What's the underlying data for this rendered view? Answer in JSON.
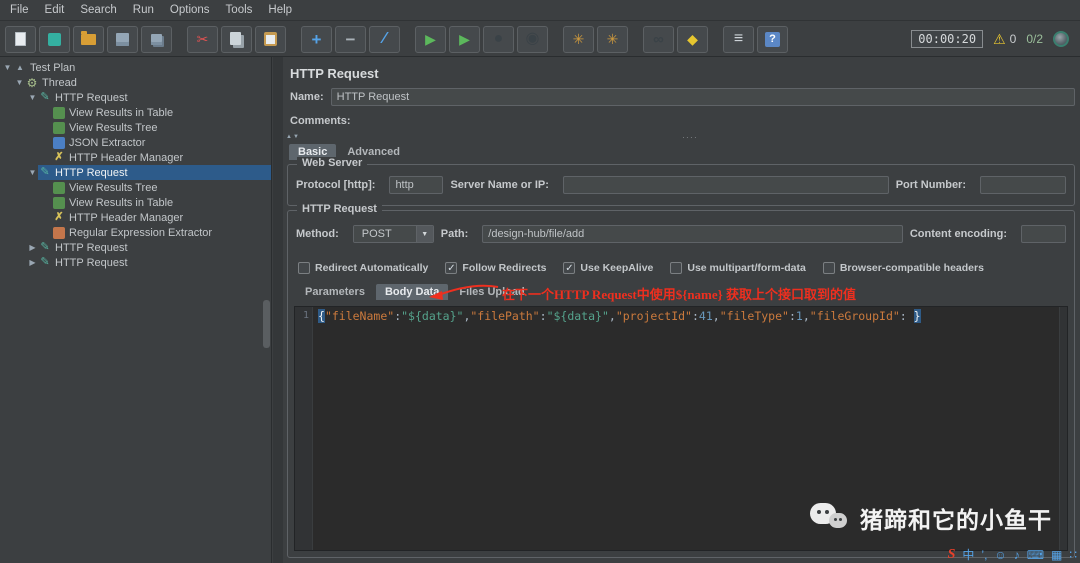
{
  "colors": {
    "selection": "#2d5b8a",
    "annotation_red": "#ee2f1f",
    "accent_blue": "#55a3e8",
    "editor_bg": "#2b2b2b"
  },
  "icons": {
    "dropdown": "▼"
  },
  "menu": {
    "items": [
      "File",
      "Edit",
      "Search",
      "Run",
      "Options",
      "Tools",
      "Help"
    ]
  },
  "toolbar": {
    "buttons": [
      {
        "name": "new-file",
        "glyph": ""
      },
      {
        "name": "open-templates",
        "glyph": ""
      },
      {
        "name": "open-file",
        "glyph": ""
      },
      {
        "name": "save",
        "glyph": ""
      },
      {
        "name": "save-as",
        "glyph": ""
      },
      {
        "name": "cut",
        "glyph": "✂"
      },
      {
        "name": "copy",
        "glyph": ""
      },
      {
        "name": "paste",
        "glyph": ""
      },
      {
        "name": "expand-all",
        "glyph": "+"
      },
      {
        "name": "collapse-all",
        "glyph": "−"
      },
      {
        "name": "toggle",
        "glyph": "∕"
      },
      {
        "name": "start",
        "glyph": "▶"
      },
      {
        "name": "start-no-timers",
        "glyph": "▶"
      },
      {
        "name": "stop",
        "glyph": "●"
      },
      {
        "name": "shutdown",
        "glyph": "◉"
      },
      {
        "name": "clear",
        "glyph": "✳"
      },
      {
        "name": "clear-all",
        "glyph": "✳"
      },
      {
        "name": "search",
        "glyph": "∞"
      },
      {
        "name": "function-helper",
        "glyph": "◆"
      },
      {
        "name": "toggle-view",
        "glyph": "≡"
      },
      {
        "name": "help",
        "glyph": "?"
      }
    ],
    "timer": "00:00:20",
    "warning_icon": "⚠",
    "warning_count": "0",
    "thread_ratio": "0/2"
  },
  "tree": {
    "items": [
      {
        "label": "Test Plan",
        "icon": "test-plan-icon",
        "state": "expanded",
        "selected": false
      },
      {
        "label": "Thread",
        "icon": "thread-group-icon",
        "state": "expanded",
        "selected": false
      },
      {
        "label": "HTTP Request",
        "icon": "http-request-icon",
        "state": "expanded",
        "selected": false
      },
      {
        "label": "View Results in Table",
        "icon": "listener-table-icon",
        "state": "leaf",
        "selected": false
      },
      {
        "label": "View Results Tree",
        "icon": "listener-tree-icon",
        "state": "leaf",
        "selected": false
      },
      {
        "label": "JSON Extractor",
        "icon": "json-extractor-icon",
        "state": "leaf",
        "selected": false
      },
      {
        "label": "HTTP Header Manager",
        "icon": "header-manager-icon",
        "state": "leaf",
        "selected": false
      },
      {
        "label": "HTTP Request",
        "icon": "http-request-icon",
        "state": "expanded",
        "selected": true
      },
      {
        "label": "View Results Tree",
        "icon": "listener-tree-icon",
        "state": "leaf",
        "selected": false
      },
      {
        "label": "View Results in Table",
        "icon": "listener-table-icon",
        "state": "leaf",
        "selected": false
      },
      {
        "label": "HTTP Header Manager",
        "icon": "header-manager-icon",
        "state": "leaf",
        "selected": false
      },
      {
        "label": "Regular Expression Extractor",
        "icon": "regex-extractor-icon",
        "state": "leaf",
        "selected": false
      },
      {
        "label": "HTTP Request",
        "icon": "http-request-icon",
        "state": "collapsed",
        "selected": false
      },
      {
        "label": "HTTP Request",
        "icon": "http-request-icon",
        "state": "collapsed",
        "selected": false
      }
    ]
  },
  "panel": {
    "title": "HTTP Request",
    "name": {
      "label": "Name:",
      "value": "HTTP Request"
    },
    "comments": {
      "label": "Comments:",
      "value": ""
    },
    "tabs": [
      {
        "label": "Basic",
        "selected": true
      },
      {
        "label": "Advanced",
        "selected": false
      }
    ],
    "web_server": {
      "title": "Web Server",
      "protocol": {
        "label": "Protocol [http]:",
        "value": "http"
      },
      "server": {
        "label": "Server Name or IP:",
        "value": ""
      },
      "port": {
        "label": "Port Number:",
        "value": ""
      }
    },
    "http_request": {
      "title": "HTTP Request",
      "method": {
        "label": "Method:",
        "value": "POST"
      },
      "path": {
        "label": "Path:",
        "value": "/design-hub/file/add"
      },
      "content_encoding": {
        "label": "Content encoding:",
        "value": ""
      },
      "options": [
        {
          "label": "Redirect Automatically",
          "checked": false
        },
        {
          "label": "Follow Redirects",
          "checked": true
        },
        {
          "label": "Use KeepAlive",
          "checked": true
        },
        {
          "label": "Use multipart/form-data",
          "checked": false
        },
        {
          "label": "Browser-compatible headers",
          "checked": false
        }
      ],
      "body_tabs": [
        {
          "label": "Parameters",
          "selected": false
        },
        {
          "label": "Body Data",
          "selected": true
        },
        {
          "label": "Files Upload",
          "selected": false
        }
      ],
      "annotation": "在下一个HTTP Request中使用${name} 获取上个接口取到的值"
    },
    "editor": {
      "line_number": "1",
      "text": "{\"fileName\":\"${data}\",\"filePath\":\"${data}\",\"projectId\":41,\"fileType\":1,\"fileGroupId\": }",
      "segments": [
        {
          "t": "{",
          "c": "brace-active"
        },
        {
          "t": "\"fileName\"",
          "c": "key"
        },
        {
          "t": ":",
          "c": "punct"
        },
        {
          "t": "\"${data}\"",
          "c": "string"
        },
        {
          "t": ",",
          "c": "punct"
        },
        {
          "t": "\"filePath\"",
          "c": "key"
        },
        {
          "t": ":",
          "c": "punct"
        },
        {
          "t": "\"${data}\"",
          "c": "string"
        },
        {
          "t": ",",
          "c": "punct"
        },
        {
          "t": "\"projectId\"",
          "c": "key"
        },
        {
          "t": ":",
          "c": "punct"
        },
        {
          "t": "41",
          "c": "number"
        },
        {
          "t": ",",
          "c": "punct"
        },
        {
          "t": "\"fileType\"",
          "c": "key"
        },
        {
          "t": ":",
          "c": "punct"
        },
        {
          "t": "1",
          "c": "number"
        },
        {
          "t": ",",
          "c": "punct"
        },
        {
          "t": "\"fileGroupId\"",
          "c": "key"
        },
        {
          "t": ": ",
          "c": "punct"
        },
        {
          "t": "}",
          "c": "brace-active"
        }
      ]
    }
  },
  "watermark": {
    "text": "猪蹄和它的小鱼干"
  },
  "input_bar": {
    "items": [
      {
        "name": "sogou-logo",
        "glyph": "S"
      },
      {
        "name": "chinese-mode",
        "glyph": "中"
      },
      {
        "name": "punctuation",
        "glyph": "’,"
      },
      {
        "name": "emoji",
        "glyph": "☺"
      },
      {
        "name": "voice",
        "glyph": "♪"
      },
      {
        "name": "keyboard",
        "glyph": "⌨"
      },
      {
        "name": "handwriting",
        "glyph": "▦"
      },
      {
        "name": "more",
        "glyph": "∷"
      }
    ]
  }
}
